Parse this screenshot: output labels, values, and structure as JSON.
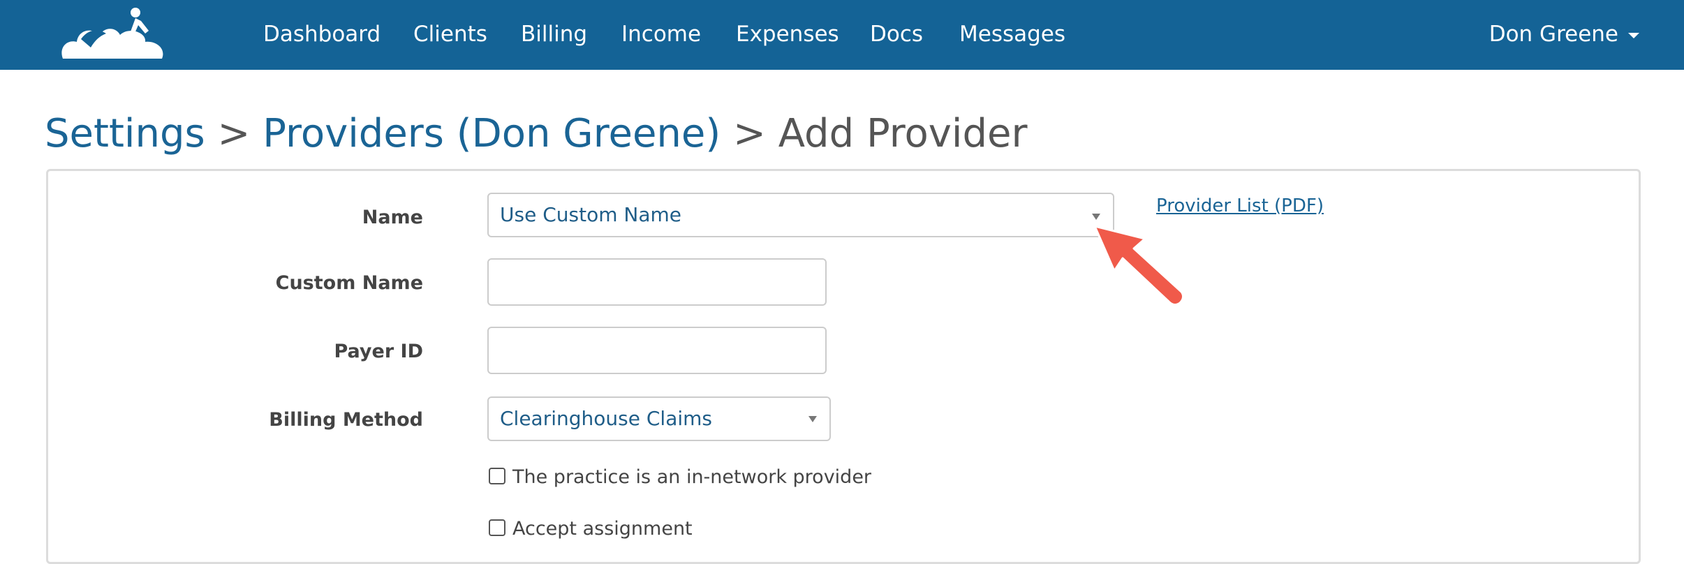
{
  "nav": {
    "items": [
      {
        "label": "Dashboard"
      },
      {
        "label": "Clients"
      },
      {
        "label": "Billing"
      },
      {
        "label": "Income"
      },
      {
        "label": "Expenses"
      },
      {
        "label": "Docs"
      },
      {
        "label": "Messages"
      }
    ],
    "user_name": "Don Greene"
  },
  "breadcrumb": {
    "settings": "Settings",
    "sep1": ">",
    "providers": "Providers (Don Greene)",
    "sep2": ">",
    "current": "Add Provider"
  },
  "form": {
    "name_label": "Name",
    "name_value": "Use Custom Name",
    "provider_list_link": "Provider List (PDF)",
    "custom_name_label": "Custom Name",
    "custom_name_value": "",
    "payer_id_label": "Payer ID",
    "payer_id_value": "",
    "billing_method_label": "Billing Method",
    "billing_method_value": "Clearinghouse Claims",
    "in_network_label": "The practice is an in-network provider",
    "accept_assignment_label": "Accept assignment"
  },
  "colors": {
    "topbar": "#146396",
    "link": "#1a6495",
    "annotation_arrow": "#f05a4a"
  }
}
